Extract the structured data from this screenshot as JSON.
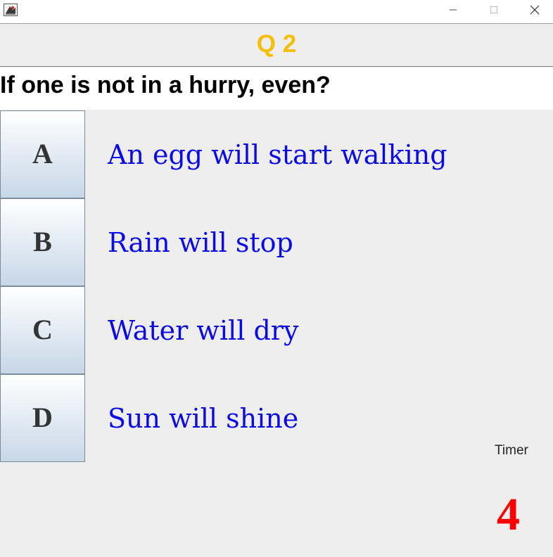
{
  "window": {
    "controls": {
      "minimize_icon": "minimize-icon",
      "maximize_icon": "maximize-icon",
      "close_icon": "close-icon"
    }
  },
  "quiz": {
    "question_number": "Q 2",
    "question_text": "If one is not in a hurry, even?",
    "options": [
      {
        "letter": "A",
        "text": "An egg will start walking"
      },
      {
        "letter": "B",
        "text": "Rain will stop"
      },
      {
        "letter": "C",
        "text": "Water will dry"
      },
      {
        "letter": "D",
        "text": "Sun will shine"
      }
    ],
    "timer_label": "Timer",
    "timer_value": "4"
  },
  "colors": {
    "question_number": "#f5be0b",
    "option_text": "#0a0ae8",
    "timer_value": "#ff0000",
    "background": "#eeeeee"
  }
}
